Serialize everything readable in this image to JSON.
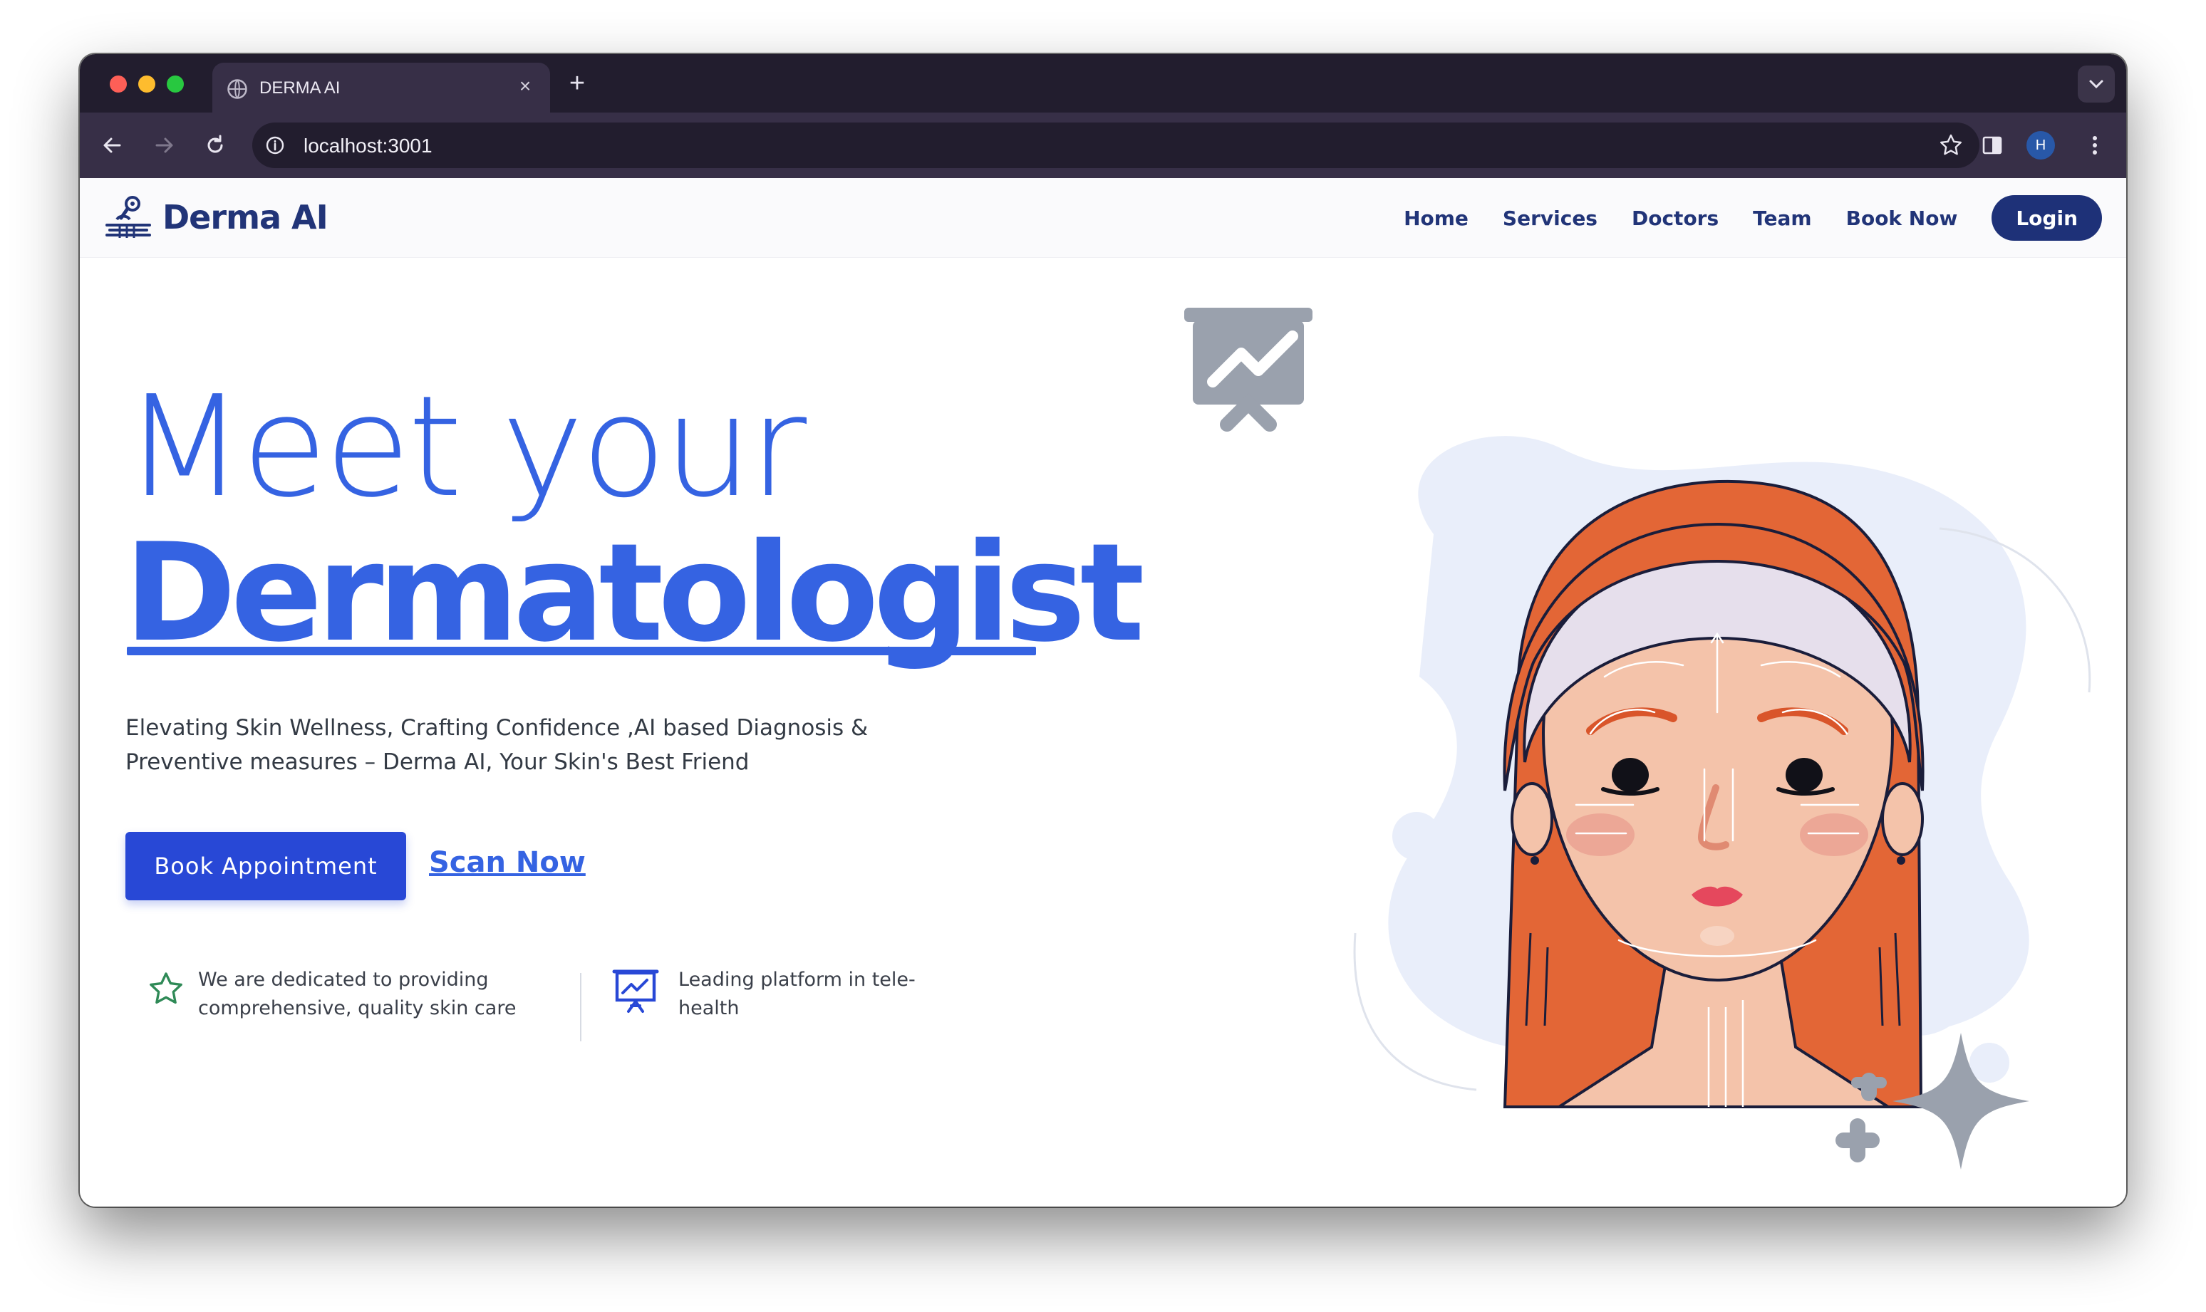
{
  "browser": {
    "tab_title": "DERMA AI",
    "tab_close": "×",
    "new_tab": "+",
    "url": "localhost:3001",
    "profile_initial": "H"
  },
  "site": {
    "brand": "Derma AI",
    "nav": [
      "Home",
      "Services",
      "Doctors",
      "Team",
      "Book Now"
    ],
    "login": "Login"
  },
  "hero": {
    "line1": "Meet your",
    "line2": "Dermatologist",
    "subtitle_line1": "Elevating Skin Wellness, Crafting Confidence ,AI based Diagnosis &",
    "subtitle_line2": "Preventive measures – Derma AI, Your Skin's Best Friend",
    "primary_cta": "Book Appointment",
    "secondary_cta": "Scan Now"
  },
  "features": [
    {
      "icon": "star-icon",
      "line1": "We are dedicated to providing",
      "line2": "comprehensive, quality skin care"
    },
    {
      "icon": "presentation-chart-icon",
      "line1": "Leading platform in tele-",
      "line2": "health"
    }
  ],
  "colors": {
    "primary": "#3563e2",
    "button": "#2848d6",
    "navy": "#1e3178",
    "icon_gray": "#9aa1ad",
    "hair": "#e36636",
    "skin": "#f4c3aa",
    "blob": "#e9eefa",
    "star_green": "#2f8a57"
  }
}
